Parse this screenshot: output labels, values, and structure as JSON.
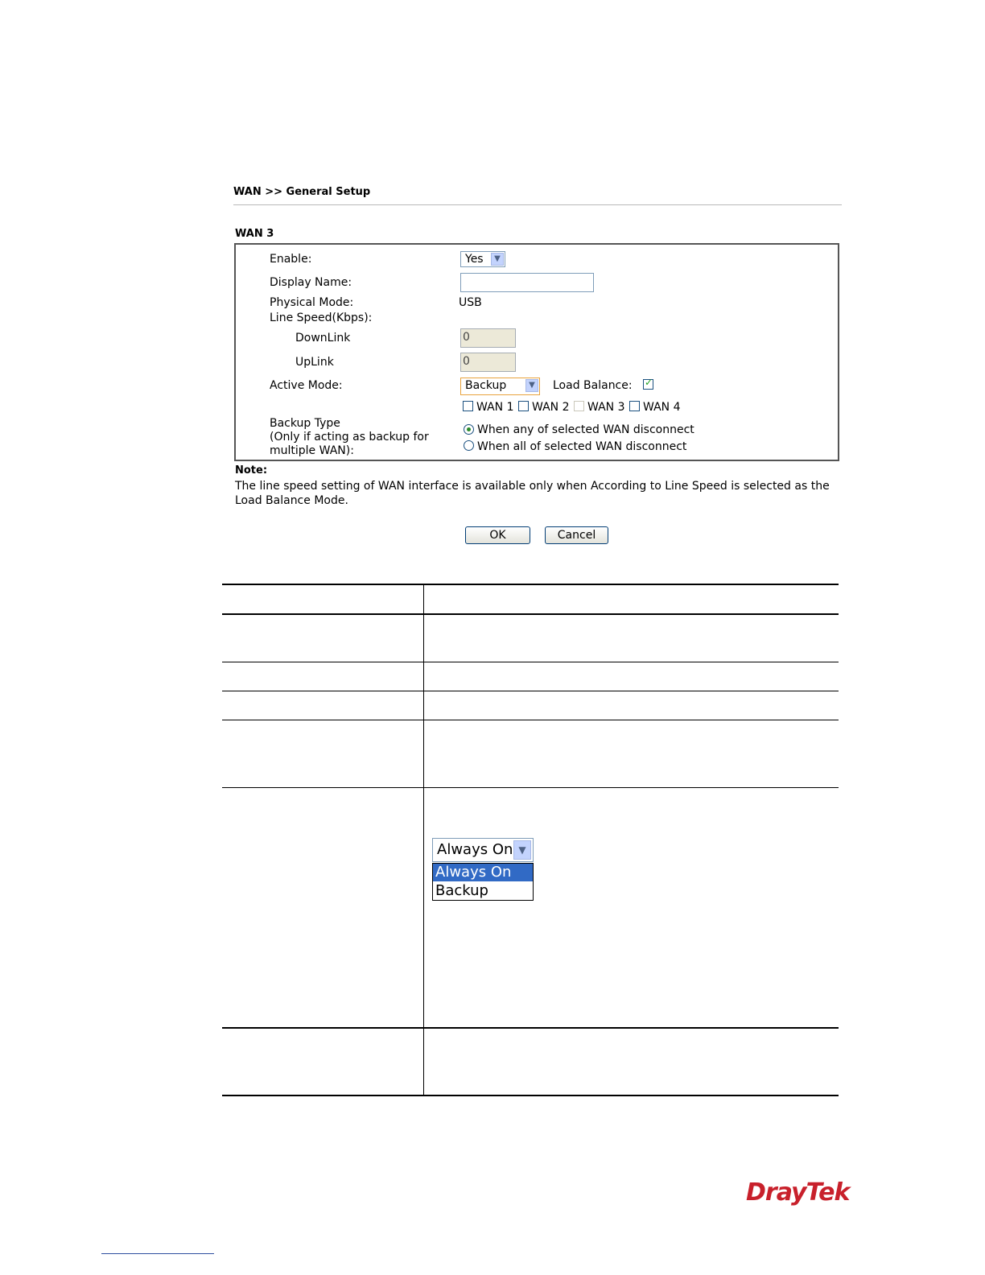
{
  "page": {
    "breadcrumb": "WAN >> General Setup",
    "section_title": "WAN 3"
  },
  "form": {
    "enable": {
      "label": "Enable:",
      "value": "Yes"
    },
    "display_name": {
      "label": "Display Name:",
      "value": ""
    },
    "physical_mode": {
      "label": "Physical Mode:",
      "value": "USB"
    },
    "line_speed": {
      "label": "Line Speed(Kbps):",
      "downlink_label": "DownLink",
      "downlink_value": "0",
      "uplink_label": "UpLink",
      "uplink_value": "0"
    },
    "active_mode": {
      "label": "Active Mode:",
      "value": "Backup"
    },
    "load_balance": {
      "label": "Load Balance:",
      "checked": true
    },
    "wan_options": [
      {
        "label": "WAN 1",
        "checked": false,
        "disabled": false
      },
      {
        "label": "WAN 2",
        "checked": false,
        "disabled": false
      },
      {
        "label": "WAN 3",
        "checked": false,
        "disabled": true
      },
      {
        "label": "WAN 4",
        "checked": false,
        "disabled": false
      }
    ],
    "backup_type": {
      "label_line1": "Backup Type",
      "label_line2": "(Only if acting as backup for",
      "label_line3": "multiple WAN):",
      "options": [
        {
          "label": "When any of selected WAN disconnect",
          "selected": true
        },
        {
          "label": "When all of selected WAN disconnect",
          "selected": false
        }
      ]
    }
  },
  "note": {
    "title": "Note:",
    "text": "The line speed setting of WAN interface is available only when According to Line Speed is selected as the Load Balance Mode."
  },
  "buttons": {
    "ok": "OK",
    "cancel": "Cancel"
  },
  "dropdown_example": {
    "current": "Always On",
    "options": [
      "Always On",
      "Backup"
    ],
    "highlighted": "Always On"
  },
  "brand": {
    "logo_text": "DrayTek",
    "color": "#c8202b"
  }
}
